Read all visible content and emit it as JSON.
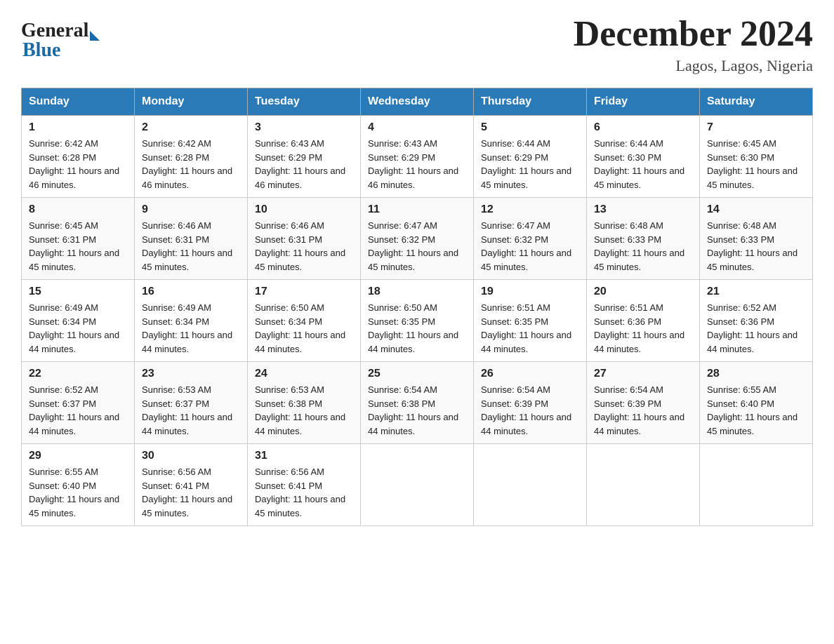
{
  "header": {
    "logo_general": "General",
    "logo_blue": "Blue",
    "title": "December 2024",
    "subtitle": "Lagos, Lagos, Nigeria"
  },
  "columns": [
    "Sunday",
    "Monday",
    "Tuesday",
    "Wednesday",
    "Thursday",
    "Friday",
    "Saturday"
  ],
  "weeks": [
    [
      {
        "day": "1",
        "sunrise": "Sunrise: 6:42 AM",
        "sunset": "Sunset: 6:28 PM",
        "daylight": "Daylight: 11 hours and 46 minutes."
      },
      {
        "day": "2",
        "sunrise": "Sunrise: 6:42 AM",
        "sunset": "Sunset: 6:28 PM",
        "daylight": "Daylight: 11 hours and 46 minutes."
      },
      {
        "day": "3",
        "sunrise": "Sunrise: 6:43 AM",
        "sunset": "Sunset: 6:29 PM",
        "daylight": "Daylight: 11 hours and 46 minutes."
      },
      {
        "day": "4",
        "sunrise": "Sunrise: 6:43 AM",
        "sunset": "Sunset: 6:29 PM",
        "daylight": "Daylight: 11 hours and 46 minutes."
      },
      {
        "day": "5",
        "sunrise": "Sunrise: 6:44 AM",
        "sunset": "Sunset: 6:29 PM",
        "daylight": "Daylight: 11 hours and 45 minutes."
      },
      {
        "day": "6",
        "sunrise": "Sunrise: 6:44 AM",
        "sunset": "Sunset: 6:30 PM",
        "daylight": "Daylight: 11 hours and 45 minutes."
      },
      {
        "day": "7",
        "sunrise": "Sunrise: 6:45 AM",
        "sunset": "Sunset: 6:30 PM",
        "daylight": "Daylight: 11 hours and 45 minutes."
      }
    ],
    [
      {
        "day": "8",
        "sunrise": "Sunrise: 6:45 AM",
        "sunset": "Sunset: 6:31 PM",
        "daylight": "Daylight: 11 hours and 45 minutes."
      },
      {
        "day": "9",
        "sunrise": "Sunrise: 6:46 AM",
        "sunset": "Sunset: 6:31 PM",
        "daylight": "Daylight: 11 hours and 45 minutes."
      },
      {
        "day": "10",
        "sunrise": "Sunrise: 6:46 AM",
        "sunset": "Sunset: 6:31 PM",
        "daylight": "Daylight: 11 hours and 45 minutes."
      },
      {
        "day": "11",
        "sunrise": "Sunrise: 6:47 AM",
        "sunset": "Sunset: 6:32 PM",
        "daylight": "Daylight: 11 hours and 45 minutes."
      },
      {
        "day": "12",
        "sunrise": "Sunrise: 6:47 AM",
        "sunset": "Sunset: 6:32 PM",
        "daylight": "Daylight: 11 hours and 45 minutes."
      },
      {
        "day": "13",
        "sunrise": "Sunrise: 6:48 AM",
        "sunset": "Sunset: 6:33 PM",
        "daylight": "Daylight: 11 hours and 45 minutes."
      },
      {
        "day": "14",
        "sunrise": "Sunrise: 6:48 AM",
        "sunset": "Sunset: 6:33 PM",
        "daylight": "Daylight: 11 hours and 45 minutes."
      }
    ],
    [
      {
        "day": "15",
        "sunrise": "Sunrise: 6:49 AM",
        "sunset": "Sunset: 6:34 PM",
        "daylight": "Daylight: 11 hours and 44 minutes."
      },
      {
        "day": "16",
        "sunrise": "Sunrise: 6:49 AM",
        "sunset": "Sunset: 6:34 PM",
        "daylight": "Daylight: 11 hours and 44 minutes."
      },
      {
        "day": "17",
        "sunrise": "Sunrise: 6:50 AM",
        "sunset": "Sunset: 6:34 PM",
        "daylight": "Daylight: 11 hours and 44 minutes."
      },
      {
        "day": "18",
        "sunrise": "Sunrise: 6:50 AM",
        "sunset": "Sunset: 6:35 PM",
        "daylight": "Daylight: 11 hours and 44 minutes."
      },
      {
        "day": "19",
        "sunrise": "Sunrise: 6:51 AM",
        "sunset": "Sunset: 6:35 PM",
        "daylight": "Daylight: 11 hours and 44 minutes."
      },
      {
        "day": "20",
        "sunrise": "Sunrise: 6:51 AM",
        "sunset": "Sunset: 6:36 PM",
        "daylight": "Daylight: 11 hours and 44 minutes."
      },
      {
        "day": "21",
        "sunrise": "Sunrise: 6:52 AM",
        "sunset": "Sunset: 6:36 PM",
        "daylight": "Daylight: 11 hours and 44 minutes."
      }
    ],
    [
      {
        "day": "22",
        "sunrise": "Sunrise: 6:52 AM",
        "sunset": "Sunset: 6:37 PM",
        "daylight": "Daylight: 11 hours and 44 minutes."
      },
      {
        "day": "23",
        "sunrise": "Sunrise: 6:53 AM",
        "sunset": "Sunset: 6:37 PM",
        "daylight": "Daylight: 11 hours and 44 minutes."
      },
      {
        "day": "24",
        "sunrise": "Sunrise: 6:53 AM",
        "sunset": "Sunset: 6:38 PM",
        "daylight": "Daylight: 11 hours and 44 minutes."
      },
      {
        "day": "25",
        "sunrise": "Sunrise: 6:54 AM",
        "sunset": "Sunset: 6:38 PM",
        "daylight": "Daylight: 11 hours and 44 minutes."
      },
      {
        "day": "26",
        "sunrise": "Sunrise: 6:54 AM",
        "sunset": "Sunset: 6:39 PM",
        "daylight": "Daylight: 11 hours and 44 minutes."
      },
      {
        "day": "27",
        "sunrise": "Sunrise: 6:54 AM",
        "sunset": "Sunset: 6:39 PM",
        "daylight": "Daylight: 11 hours and 44 minutes."
      },
      {
        "day": "28",
        "sunrise": "Sunrise: 6:55 AM",
        "sunset": "Sunset: 6:40 PM",
        "daylight": "Daylight: 11 hours and 45 minutes."
      }
    ],
    [
      {
        "day": "29",
        "sunrise": "Sunrise: 6:55 AM",
        "sunset": "Sunset: 6:40 PM",
        "daylight": "Daylight: 11 hours and 45 minutes."
      },
      {
        "day": "30",
        "sunrise": "Sunrise: 6:56 AM",
        "sunset": "Sunset: 6:41 PM",
        "daylight": "Daylight: 11 hours and 45 minutes."
      },
      {
        "day": "31",
        "sunrise": "Sunrise: 6:56 AM",
        "sunset": "Sunset: 6:41 PM",
        "daylight": "Daylight: 11 hours and 45 minutes."
      },
      null,
      null,
      null,
      null
    ]
  ]
}
